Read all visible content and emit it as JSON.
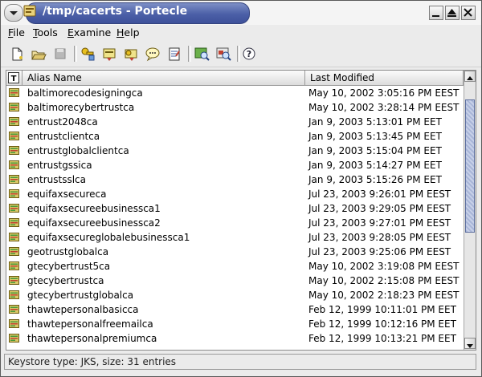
{
  "window": {
    "title": "/tmp/cacerts - Portecle"
  },
  "menubar": {
    "items": [
      {
        "label": "File",
        "mnemonic": "F"
      },
      {
        "label": "Tools",
        "mnemonic": "T"
      },
      {
        "label": "Examine",
        "mnemonic": "E"
      },
      {
        "label": "Help",
        "mnemonic": "H"
      }
    ]
  },
  "toolbar": {
    "buttons": [
      {
        "icon": "new-keystore-icon"
      },
      {
        "icon": "open-keystore-icon"
      },
      {
        "icon": "save-keystore-icon"
      },
      {
        "icon": "generate-keypair-icon"
      },
      {
        "icon": "import-certificate-icon"
      },
      {
        "icon": "import-keypair-icon"
      },
      {
        "icon": "set-password-icon"
      },
      {
        "icon": "keystore-report-icon"
      },
      {
        "icon": "examine-certificate-icon"
      },
      {
        "icon": "examine-ssl-icon"
      },
      {
        "icon": "help-icon"
      }
    ]
  },
  "table": {
    "corner_icon": "T",
    "columns": {
      "alias": "Alias Name",
      "modified": "Last Modified"
    },
    "rows": [
      {
        "alias": "baltimorecodesigningca",
        "modified": "May 10, 2002 3:05:16 PM EEST"
      },
      {
        "alias": "baltimorecybertrustca",
        "modified": "May 10, 2002 3:28:14 PM EEST"
      },
      {
        "alias": "entrust2048ca",
        "modified": "Jan 9, 2003 5:13:01 PM EET"
      },
      {
        "alias": "entrustclientca",
        "modified": "Jan 9, 2003 5:13:45 PM EET"
      },
      {
        "alias": "entrustglobalclientca",
        "modified": "Jan 9, 2003 5:15:04 PM EET"
      },
      {
        "alias": "entrustgssica",
        "modified": "Jan 9, 2003 5:14:27 PM EET"
      },
      {
        "alias": "entrustsslca",
        "modified": "Jan 9, 2003 5:15:26 PM EET"
      },
      {
        "alias": "equifaxsecureca",
        "modified": "Jul 23, 2003 9:26:01 PM EEST"
      },
      {
        "alias": "equifaxsecureebusinessca1",
        "modified": "Jul 23, 2003 9:29:05 PM EEST"
      },
      {
        "alias": "equifaxsecureebusinessca2",
        "modified": "Jul 23, 2003 9:27:01 PM EEST"
      },
      {
        "alias": "equifaxsecureglobalebusinessca1",
        "modified": "Jul 23, 2003 9:28:05 PM EEST"
      },
      {
        "alias": "geotrustglobalca",
        "modified": "Jul 23, 2003 9:25:06 PM EEST"
      },
      {
        "alias": "gtecybertrust5ca",
        "modified": "May 10, 2002 3:19:08 PM EEST"
      },
      {
        "alias": "gtecybertrustca",
        "modified": "May 10, 2002 2:15:08 PM EEST"
      },
      {
        "alias": "gtecybertrustglobalca",
        "modified": "May 10, 2002 2:18:23 PM EEST"
      },
      {
        "alias": "thawtepersonalbasicca",
        "modified": "Feb 12, 1999 10:11:01 PM EET"
      },
      {
        "alias": "thawtepersonalfreemailca",
        "modified": "Feb 12, 1999 10:12:16 PM EET"
      },
      {
        "alias": "thawtepersonalpremiumca",
        "modified": "Feb 12, 1999 10:13:21 PM EET"
      }
    ]
  },
  "status": {
    "text": "Keystore type: JKS, size: 31 entries"
  },
  "colors": {
    "title_bar": "#4b5fa7",
    "scroll_thumb": "#a9b6d8",
    "cert_icon": "#4a9a3a"
  }
}
